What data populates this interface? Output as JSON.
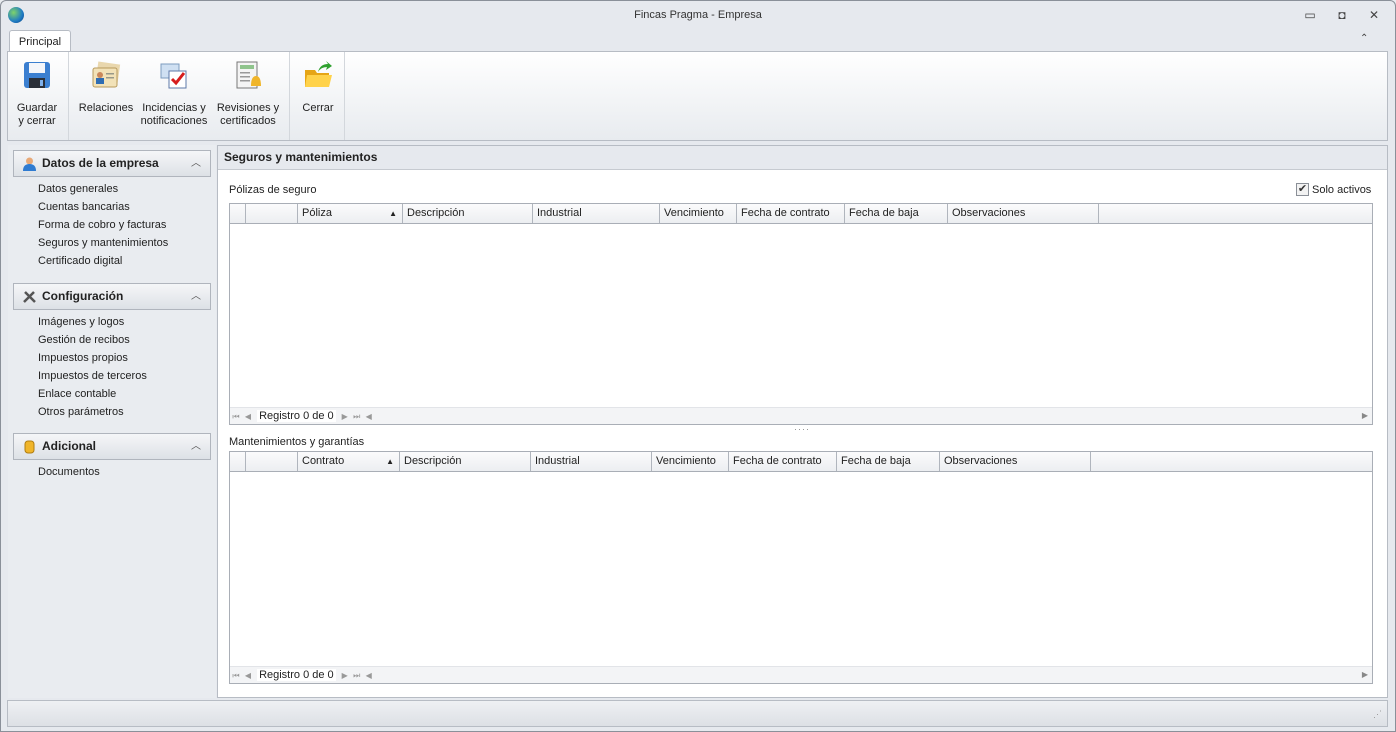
{
  "window": {
    "title": "Fincas Pragma - Empresa"
  },
  "ribbon": {
    "tab": "Principal",
    "buttons": [
      {
        "l1": "Guardar",
        "l2": "y cerrar",
        "icon": "floppy-disk-icon"
      },
      {
        "l1": "Relaciones",
        "l2": "",
        "icon": "contact-cards-icon"
      },
      {
        "l1": "Incidencias y",
        "l2": "notificaciones",
        "icon": "checked-mail-icon"
      },
      {
        "l1": "Revisiones y",
        "l2": "certificados",
        "icon": "calendar-bell-icon"
      },
      {
        "l1": "Cerrar",
        "l2": "",
        "icon": "open-folder-arrow-icon"
      }
    ]
  },
  "sidebar": {
    "groups": [
      {
        "title": "Datos de la empresa",
        "icon": "user-icon",
        "items": [
          "Datos generales",
          "Cuentas bancarias",
          "Forma de cobro y facturas",
          "Seguros y mantenimientos",
          "Certificado digital"
        ]
      },
      {
        "title": "Configuración",
        "icon": "tools-icon",
        "items": [
          "Imágenes y logos",
          "Gestión de recibos",
          "Impuestos propios",
          "Impuestos de terceros",
          "Enlace contable",
          "Otros parámetros"
        ]
      },
      {
        "title": "Adicional",
        "icon": "database-icon",
        "items": [
          "Documentos"
        ]
      }
    ]
  },
  "main": {
    "title": "Seguros y mantenimientos",
    "solo_activos": {
      "label": "Solo activos",
      "checked": true
    },
    "grids": [
      {
        "label": "Pólizas de seguro",
        "columns": [
          "",
          "",
          "Póliza",
          "Descripción",
          "Industrial",
          "Vencimiento",
          "Fecha de contrato",
          "Fecha de baja",
          "Observaciones"
        ],
        "sorted": 2,
        "footer": "Registro 0 de 0"
      },
      {
        "label": "Mantenimientos y garantías",
        "columns": [
          "",
          "",
          "Contrato",
          "Descripción",
          "Industrial",
          "Vencimiento",
          "Fecha de contrato",
          "Fecha de baja",
          "Observaciones"
        ],
        "sorted": 2,
        "footer": "Registro 0 de 0"
      }
    ]
  }
}
